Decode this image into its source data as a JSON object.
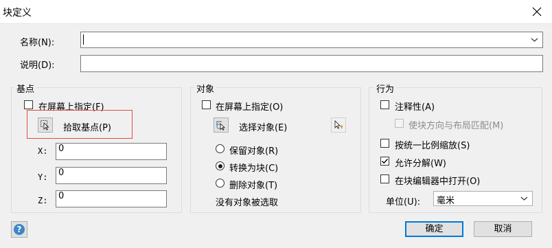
{
  "window": {
    "title": "块定义",
    "close_glyph": "✕"
  },
  "name_field": {
    "label": "名称(N):",
    "value": ""
  },
  "desc_field": {
    "label": "说明(D):",
    "value": ""
  },
  "base_point": {
    "title": "基点",
    "specify_on_screen": {
      "label": "在屏幕上指定(F)",
      "checked": false
    },
    "pick_button_label": "拾取基点(P)",
    "x": {
      "label": "X:",
      "value": "0"
    },
    "y": {
      "label": "Y:",
      "value": "0"
    },
    "z": {
      "label": "Z:",
      "value": "0"
    }
  },
  "objects": {
    "title": "对象",
    "specify_on_screen": {
      "label": "在屏幕上指定(O)",
      "checked": false
    },
    "select_button_label": "选择对象(E)",
    "retain": {
      "label": "保留对象(R)",
      "selected": false
    },
    "convert": {
      "label": "转换为块(C)",
      "selected": true
    },
    "delete": {
      "label": "删除对象(T)",
      "selected": false
    },
    "status": "没有对象被选取"
  },
  "behavior": {
    "title": "行为",
    "annotative": {
      "label": "注释性(A)",
      "checked": false
    },
    "match_orientation": {
      "label": "使块方向与布局匹配(M)",
      "checked": false,
      "enabled": false
    },
    "scale_uniformly": {
      "label": "按统一比例缩放(S)",
      "checked": false
    },
    "allow_exploding": {
      "label": "允许分解(W)",
      "checked": true
    },
    "open_in_editor": {
      "label": "在块编辑器中打开(O)",
      "checked": false
    },
    "unit_label": "单位(U):",
    "unit_value": "毫米"
  },
  "buttons": {
    "ok": "确定",
    "cancel": "取消",
    "help": "?"
  },
  "colors": {
    "highlight": "#e04c40",
    "accent": "#0078d7"
  }
}
